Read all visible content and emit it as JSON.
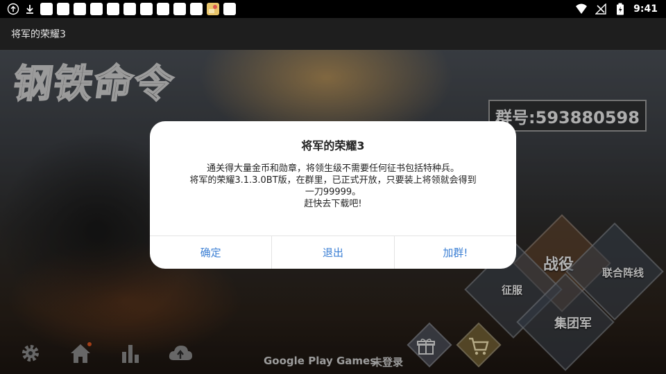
{
  "status_bar": {
    "time": "9:41",
    "left_icons": [
      "sync-icon",
      "download-icon",
      "notification-icon",
      "notification-icon",
      "notification-icon",
      "notification-icon",
      "notification-icon",
      "notification-icon",
      "notification-icon",
      "notification-icon",
      "notification-icon",
      "notification-icon",
      "app-icon",
      "notification-icon"
    ],
    "right_icons": [
      "wifi-icon",
      "no-signal-icon",
      "battery-icon"
    ]
  },
  "titlebar": {
    "title": "将军的荣耀3"
  },
  "game": {
    "logo": "钢铁命令",
    "group_id": "群号:593880598",
    "menu": {
      "campaign": "战役",
      "conquest": "征服",
      "alliance_front": "联合阵线",
      "army_group": "集团军"
    },
    "google_play": "Google Play Games",
    "login_status": "未登录"
  },
  "dialog": {
    "title": "将军的荣耀3",
    "lines": [
      "通关得大量金币和勋章，将领生级不需要任何征书包括特种兵。",
      "将军的荣耀3.1.3.0BT版，在群里，已正式开放，只要装上将领就会得到",
      "一刀99999。",
      "赶快去下载吧!"
    ],
    "buttons": {
      "confirm": "确定",
      "exit": "退出",
      "join_group": "加群!"
    }
  },
  "colors": {
    "dialog_button": "#3b7fd4",
    "titlebar_bg": "#1e1e1e",
    "gift_diamond": "#7d6a38"
  }
}
